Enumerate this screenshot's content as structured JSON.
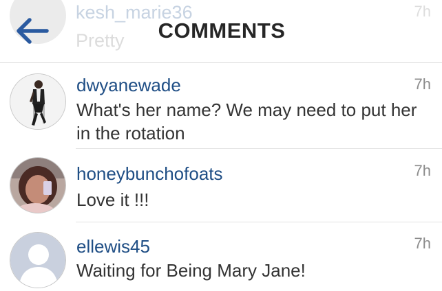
{
  "header": {
    "title": "COMMENTS",
    "back_icon": "back-arrow-icon",
    "accent_color": "#2a5aa0"
  },
  "previous_comment": {
    "username": "kesh_marie36",
    "text": "Pretty",
    "time": "7h"
  },
  "comments": [
    {
      "username": "dwyanewade",
      "time": "7h",
      "text": "What's her name? We may need to put her in the rotation",
      "avatar": "profile-photo"
    },
    {
      "username": "honeybunchofoats",
      "time": "7h",
      "text": "Love it !!!",
      "avatar": "profile-photo"
    },
    {
      "username": "ellewis45",
      "time": "7h",
      "text": "Waiting for Being Mary Jane!",
      "avatar": "default-avatar-icon"
    }
  ]
}
